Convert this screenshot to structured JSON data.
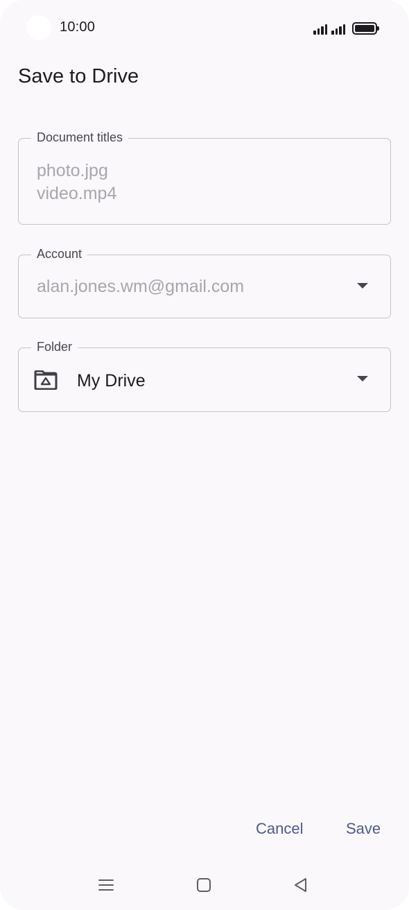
{
  "status_bar": {
    "time": "10:00",
    "icons": [
      "signal-icon",
      "signal-icon",
      "battery-icon"
    ]
  },
  "dialog": {
    "title": "Save to Drive",
    "document_titles": {
      "label": "Document titles",
      "lines": [
        "photo.jpg",
        "video.mp4"
      ]
    },
    "account": {
      "label": "Account",
      "value": "alan.jones.wm@gmail.com"
    },
    "folder": {
      "label": "Folder",
      "value": "My Drive",
      "icon": "drive-folder-icon"
    },
    "cancel_label": "Cancel",
    "save_label": "Save"
  },
  "nav_bar": {
    "icons": [
      "recents-icon",
      "home-icon",
      "back-icon"
    ]
  },
  "colors": {
    "background": "#fbf8fc",
    "accent": "#4d5a8c",
    "outline": "#c5c3c9",
    "disabled_text": "#a8a6ac"
  }
}
